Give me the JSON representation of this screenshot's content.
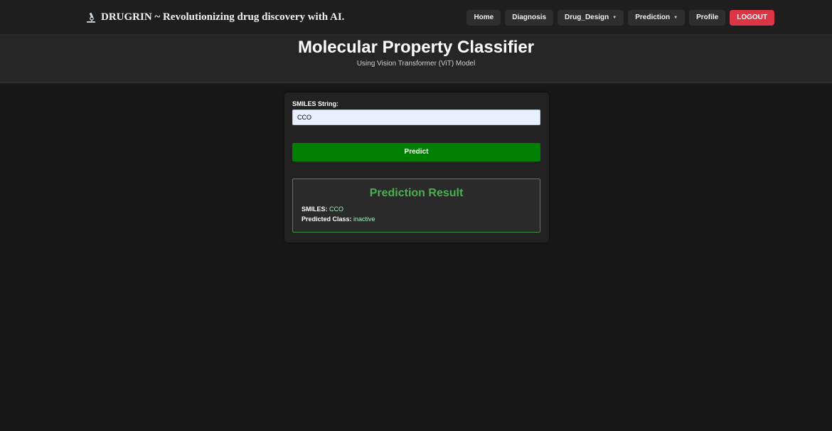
{
  "navbar": {
    "brand_text": "DRUGRIN ~ Revolutionizing drug discovery with AI.",
    "brand_icon": "microscope-icon",
    "items": [
      {
        "label": "Home",
        "dropdown": false
      },
      {
        "label": "Diagnosis",
        "dropdown": false
      },
      {
        "label": "Drug_Design",
        "dropdown": true
      },
      {
        "label": "Prediction",
        "dropdown": true
      },
      {
        "label": "Profile",
        "dropdown": false
      }
    ],
    "logout_label": "LOGOUT",
    "caret": "▼"
  },
  "header": {
    "title": "Molecular Property Classifier",
    "subtitle": "Using Vision Transformer (ViT) Model"
  },
  "form": {
    "smiles_label": "SMILES String:",
    "smiles_value": "CCO",
    "predict_label": "Predict"
  },
  "result": {
    "title": "Prediction Result",
    "smiles_key": "SMILES:",
    "smiles_value": "CCO",
    "class_key": "Predicted Class:",
    "class_value": "inactive"
  },
  "colors": {
    "accent_green": "#008000",
    "result_title": "#4caf50",
    "logout_red": "#dc3545"
  }
}
